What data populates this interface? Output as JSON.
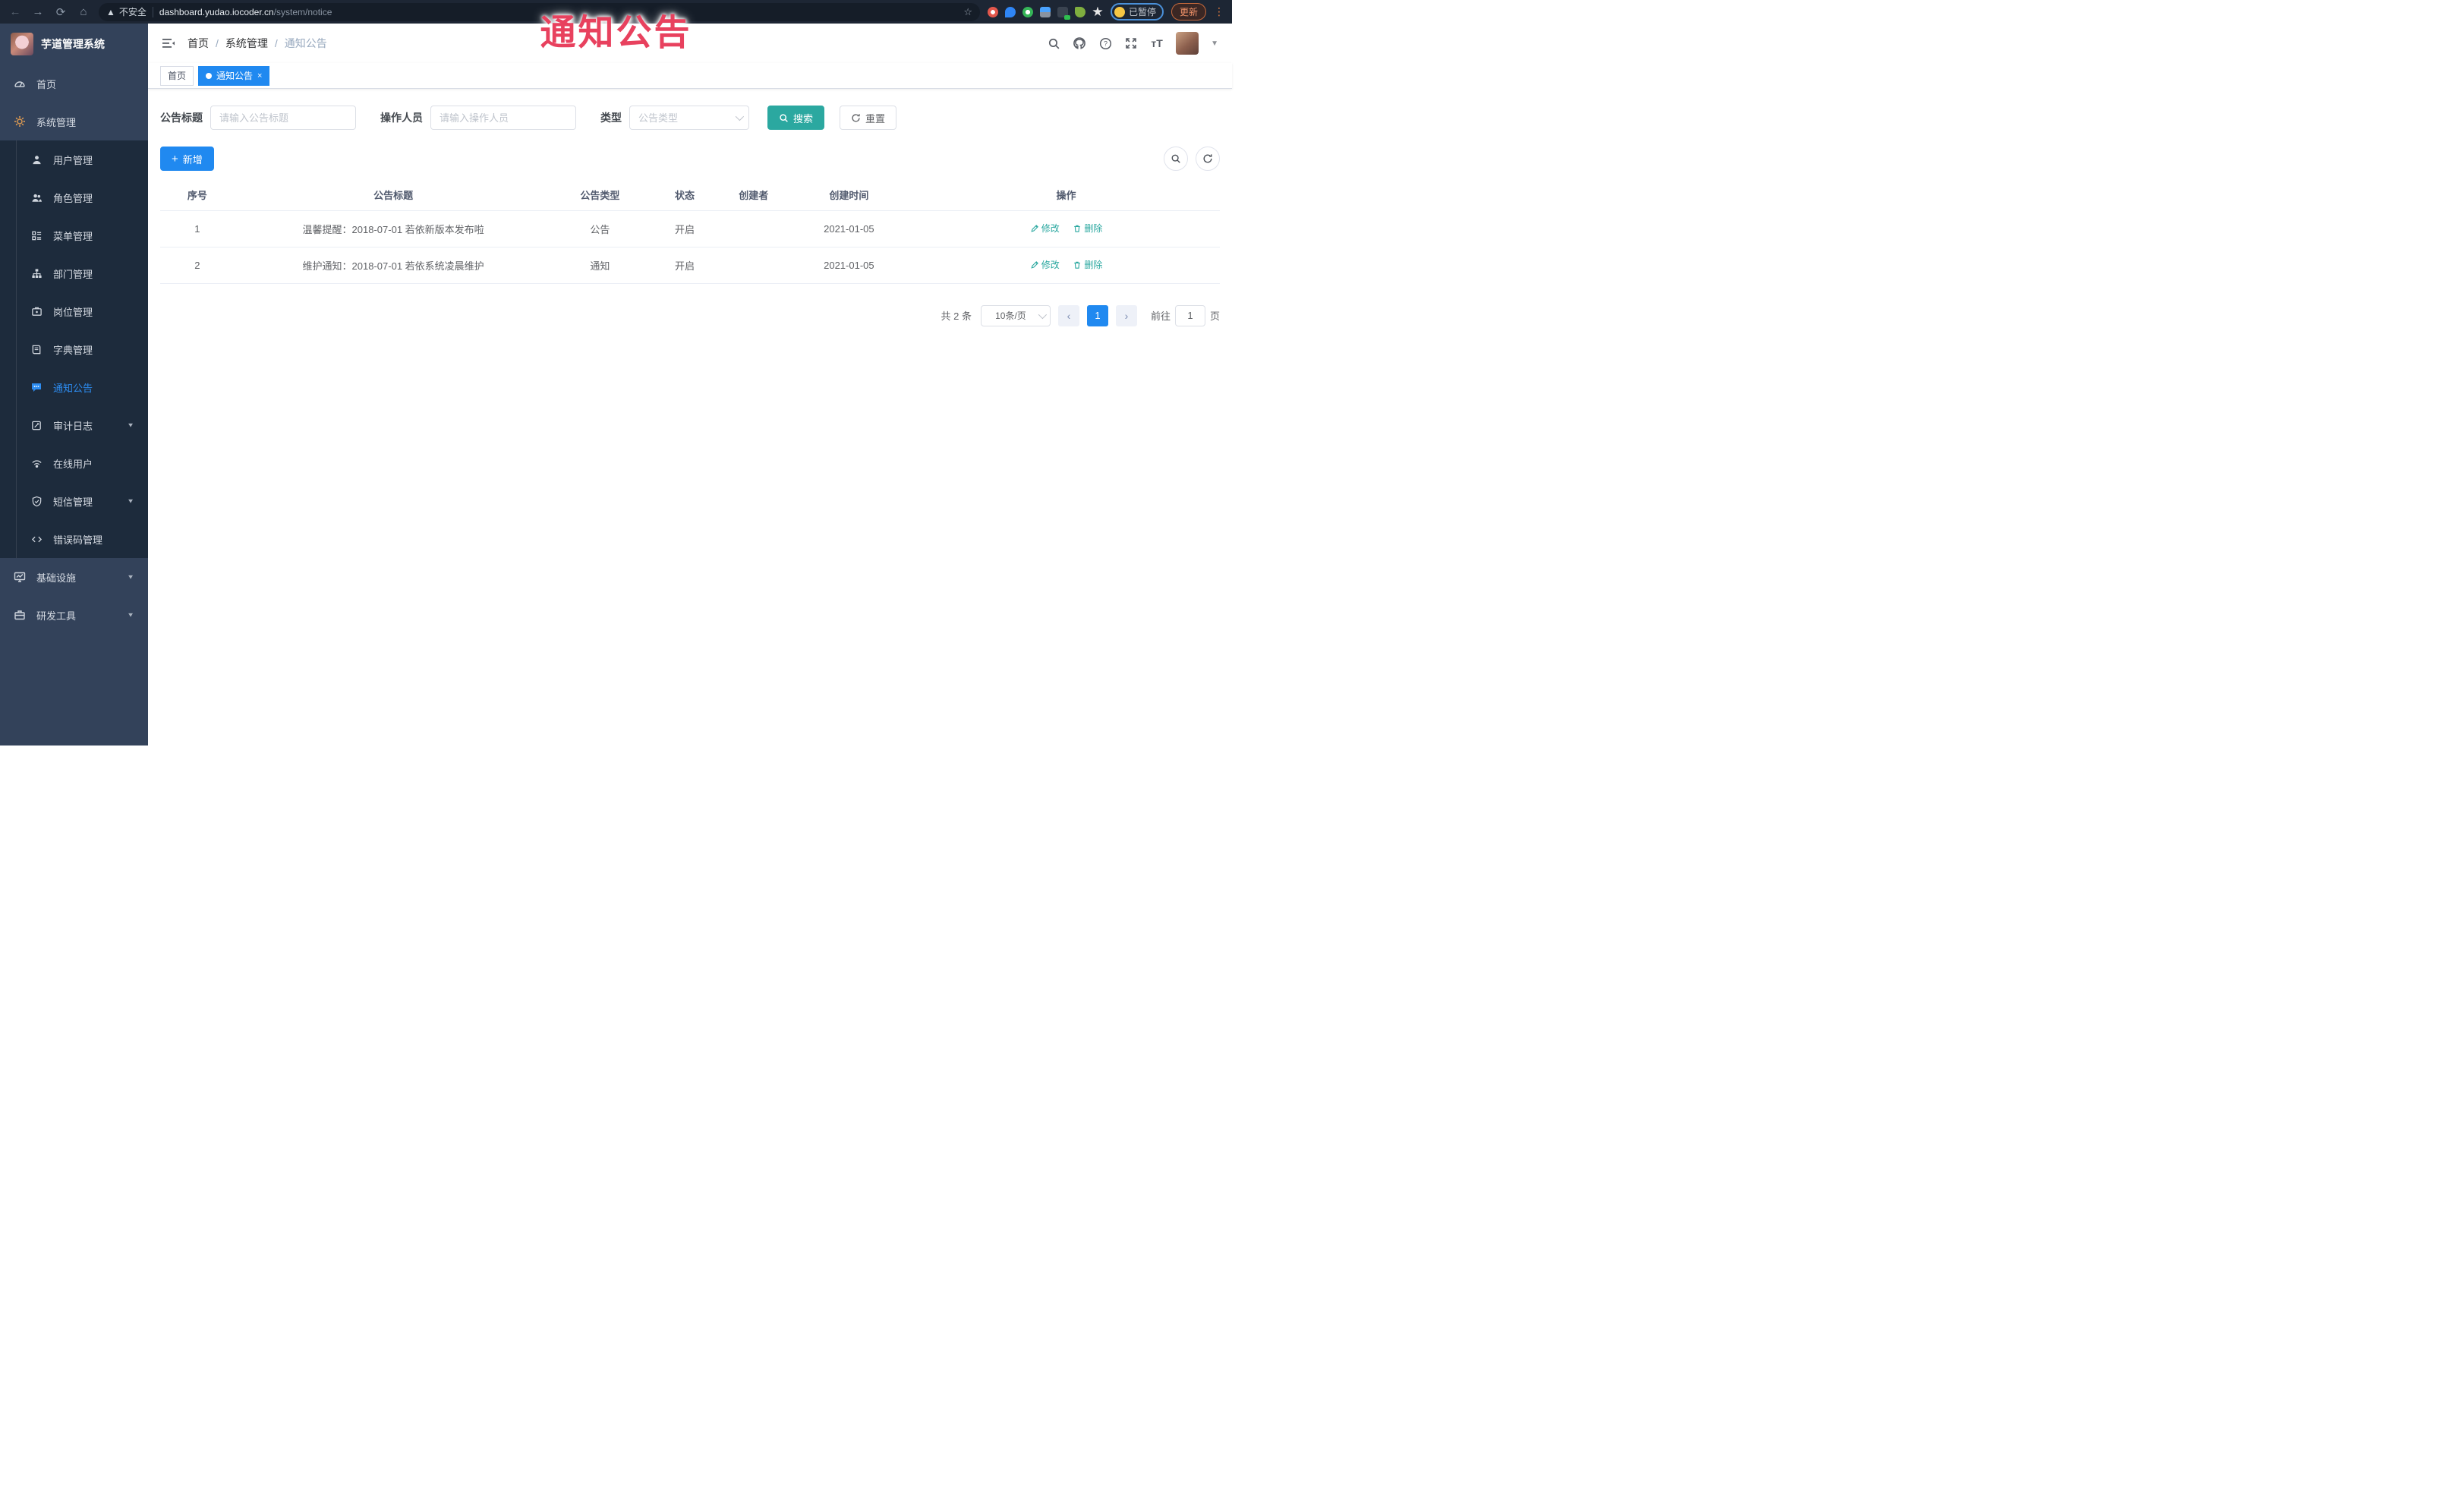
{
  "overlay": {
    "text": "通知公告",
    "color": "#e8415e"
  },
  "browser": {
    "security_warning": "不安全",
    "url_host": "dashboard.yudao.iocoder.cn",
    "url_path": "/system/notice",
    "bookmark_glyph": "☆",
    "profile_label": "已暂停",
    "update_label": "更新",
    "extensions": [
      {
        "name": "extension-orange",
        "color": "#e2574c"
      },
      {
        "name": "extension-blue-pin",
        "color": "#2f86f6"
      },
      {
        "name": "extension-green-circle",
        "color": "#35b558"
      },
      {
        "name": "extension-blue-gem",
        "color": "#5a7d9c"
      },
      {
        "name": "extension-dark-on",
        "color": "#3a4350"
      },
      {
        "name": "extension-green-leaf",
        "color": "#7fae3f"
      },
      {
        "name": "extension-white-star",
        "color": "#e8e8e8"
      }
    ]
  },
  "sidebar": {
    "logo_title": "芋道管理系统",
    "items": [
      {
        "icon": "gauge-icon",
        "label": "首页"
      },
      {
        "icon": "gear-icon",
        "label": "系统管理",
        "expanded": true
      },
      {
        "icon": "monitor-icon",
        "label": "基础设施",
        "has_children": true
      },
      {
        "icon": "tools-icon",
        "label": "研发工具",
        "has_children": true
      }
    ],
    "system_children": [
      {
        "icon": "user-icon",
        "label": "用户管理"
      },
      {
        "icon": "users-icon",
        "label": "角色管理"
      },
      {
        "icon": "menu-list-icon",
        "label": "菜单管理"
      },
      {
        "icon": "org-tree-icon",
        "label": "部门管理"
      },
      {
        "icon": "post-icon",
        "label": "岗位管理"
      },
      {
        "icon": "book-icon",
        "label": "字典管理"
      },
      {
        "icon": "chat-bubble-icon",
        "label": "通知公告",
        "active": true
      },
      {
        "icon": "audit-icon",
        "label": "审计日志",
        "has_children": true
      },
      {
        "icon": "online-icon",
        "label": "在线用户"
      },
      {
        "icon": "sms-shield-icon",
        "label": "短信管理",
        "has_children": true
      },
      {
        "icon": "code-icon",
        "label": "错误码管理"
      }
    ]
  },
  "header": {
    "breadcrumb": [
      "首页",
      "系统管理",
      "通知公告"
    ],
    "separator": "/"
  },
  "tabs": [
    {
      "label": "首页",
      "active": false
    },
    {
      "label": "通知公告",
      "active": true,
      "close_glyph": "×"
    }
  ],
  "filters": {
    "title_label": "公告标题",
    "title_placeholder": "请输入公告标题",
    "operator_label": "操作人员",
    "operator_placeholder": "请输入操作人员",
    "type_label": "类型",
    "type_placeholder": "公告类型",
    "search_label": "搜索",
    "reset_label": "重置"
  },
  "toolbar": {
    "add_label": "新增"
  },
  "table": {
    "columns": [
      "序号",
      "公告标题",
      "公告类型",
      "状态",
      "创建者",
      "创建时间",
      "操作"
    ],
    "rows": [
      {
        "index": "1",
        "title": "温馨提醒：2018-07-01 若依新版本发布啦",
        "type": "公告",
        "status": "开启",
        "creator": "",
        "created_at": "2021-01-05"
      },
      {
        "index": "2",
        "title": "维护通知：2018-07-01 若依系统凌晨维护",
        "type": "通知",
        "status": "开启",
        "creator": "",
        "created_at": "2021-01-05"
      }
    ],
    "edit_label": "修改",
    "delete_label": "删除"
  },
  "pagination": {
    "total_text": "共 2 条",
    "page_size": "10条/页",
    "prev_glyph": "‹",
    "current_page": "1",
    "next_glyph": "›",
    "goto_label": "前往",
    "goto_value": "1",
    "page_suffix": "页"
  },
  "colors": {
    "primary_blue": "#2089f0",
    "teal": "#2ba8a0",
    "overlay_red": "#e8415e",
    "sidebar_bg": "#33425a",
    "submenu_bg": "#1d2b3c",
    "browser_bar": "#1d2634"
  }
}
